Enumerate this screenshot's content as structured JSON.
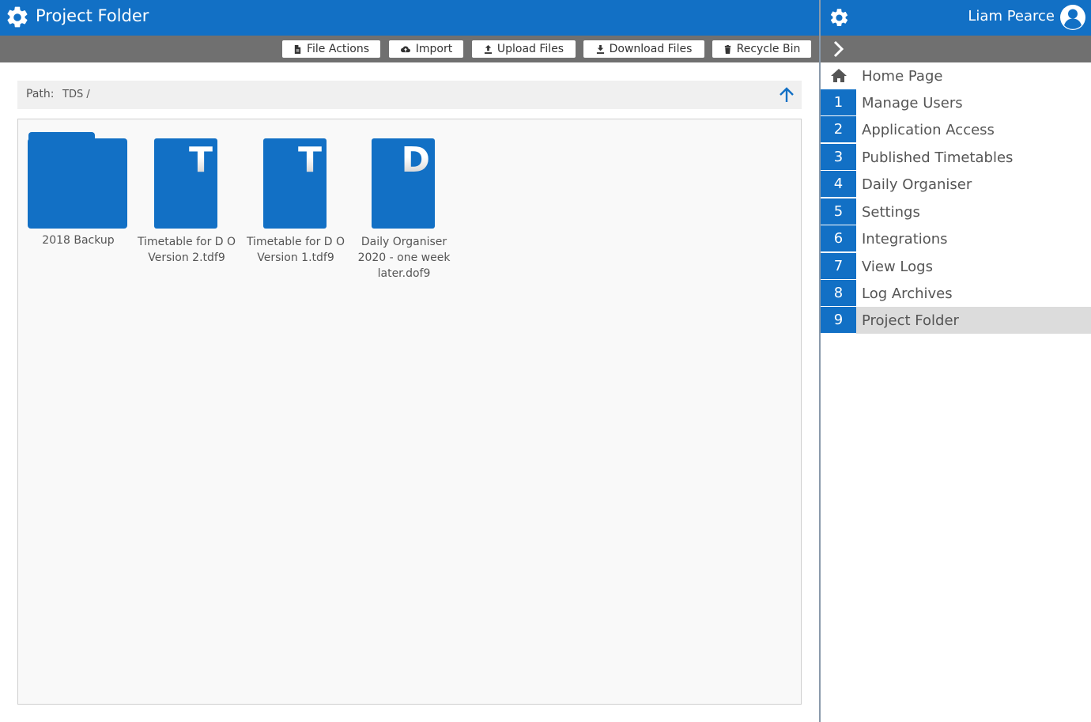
{
  "app": {
    "title": "Project Folder",
    "icon": "gear-icon"
  },
  "toolbar": {
    "file_actions": "File Actions",
    "import": "Import",
    "upload": "Upload Files",
    "download": "Download Files",
    "recycle": "Recycle Bin"
  },
  "path": {
    "label": "Path:",
    "value": "TDS /"
  },
  "files": [
    {
      "type": "folder",
      "name": "2018 Backup"
    },
    {
      "type": "file",
      "letter": "T",
      "name": "Timetable for D O Version 2.tdf9"
    },
    {
      "type": "file",
      "letter": "T",
      "name": "Timetable for D O Version 1.tdf9"
    },
    {
      "type": "file",
      "letter": "D",
      "name": "Daily Organiser 2020 - one week later.dof9"
    }
  ],
  "user": {
    "name": "Liam Pearce"
  },
  "nav": {
    "home": "Home Page",
    "items": [
      {
        "num": "1",
        "label": "Manage Users"
      },
      {
        "num": "2",
        "label": "Application Access"
      },
      {
        "num": "3",
        "label": "Published Timetables"
      },
      {
        "num": "4",
        "label": "Daily Organiser"
      },
      {
        "num": "5",
        "label": "Settings"
      },
      {
        "num": "6",
        "label": "Integrations"
      },
      {
        "num": "7",
        "label": "View Logs"
      },
      {
        "num": "8",
        "label": "Log Archives"
      },
      {
        "num": "9",
        "label": "Project Folder",
        "active": true
      }
    ]
  },
  "colors": {
    "primary": "#1270c5",
    "toolbar": "#707070",
    "active_row": "#dcdcdc"
  }
}
